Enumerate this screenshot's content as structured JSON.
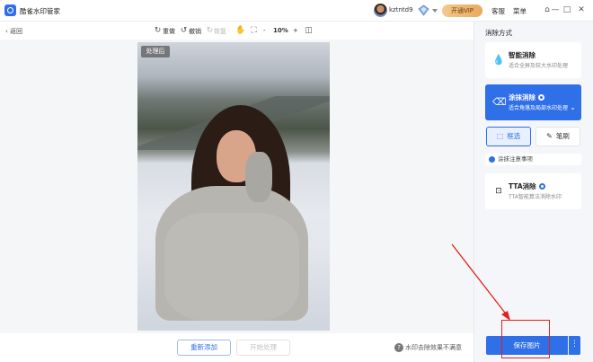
{
  "titlebar": {
    "app_title": "酷雀水印管家",
    "username": "kztntd9",
    "vip_label": "开通VIP",
    "service_label": "客服",
    "menu_label": "菜单",
    "min_symbol": "—",
    "max_symbol": "□",
    "close_symbol": "✕",
    "skin_symbol": "⌂"
  },
  "toolbar": {
    "back_label": "返回",
    "redo_label": "重做",
    "undo_label": "撤销",
    "restore_label": "恢复",
    "zoom_minus": "-",
    "zoom_value": "10%",
    "zoom_plus": "+"
  },
  "canvas": {
    "after_badge": "处理后"
  },
  "actions": {
    "readd_label": "重新添加",
    "start_label": "开始处理",
    "help_symbol": "?",
    "help_text": "水印去除效果不满意"
  },
  "panel": {
    "title": "消除方式",
    "modes": [
      {
        "title": "智能消除",
        "desc": "适合全屏及较大水印处理",
        "icon": "drop-icon"
      },
      {
        "title": "涂抹消除",
        "desc": "适合角落及局部水印处理",
        "icon": "eraser-icon"
      },
      {
        "title": "TTA消除",
        "desc": "TTA智能算法消除水印",
        "icon": "tta-icon"
      }
    ],
    "tool_select": "框选",
    "tool_brush": "笔刷",
    "notice": "涂抹注意事项",
    "save_label": "保存图片",
    "more_symbol": "⋮"
  },
  "colors": {
    "accent": "#2f6fe8",
    "annotation": "#e0221c",
    "vip_gold": "#e8a95e"
  }
}
